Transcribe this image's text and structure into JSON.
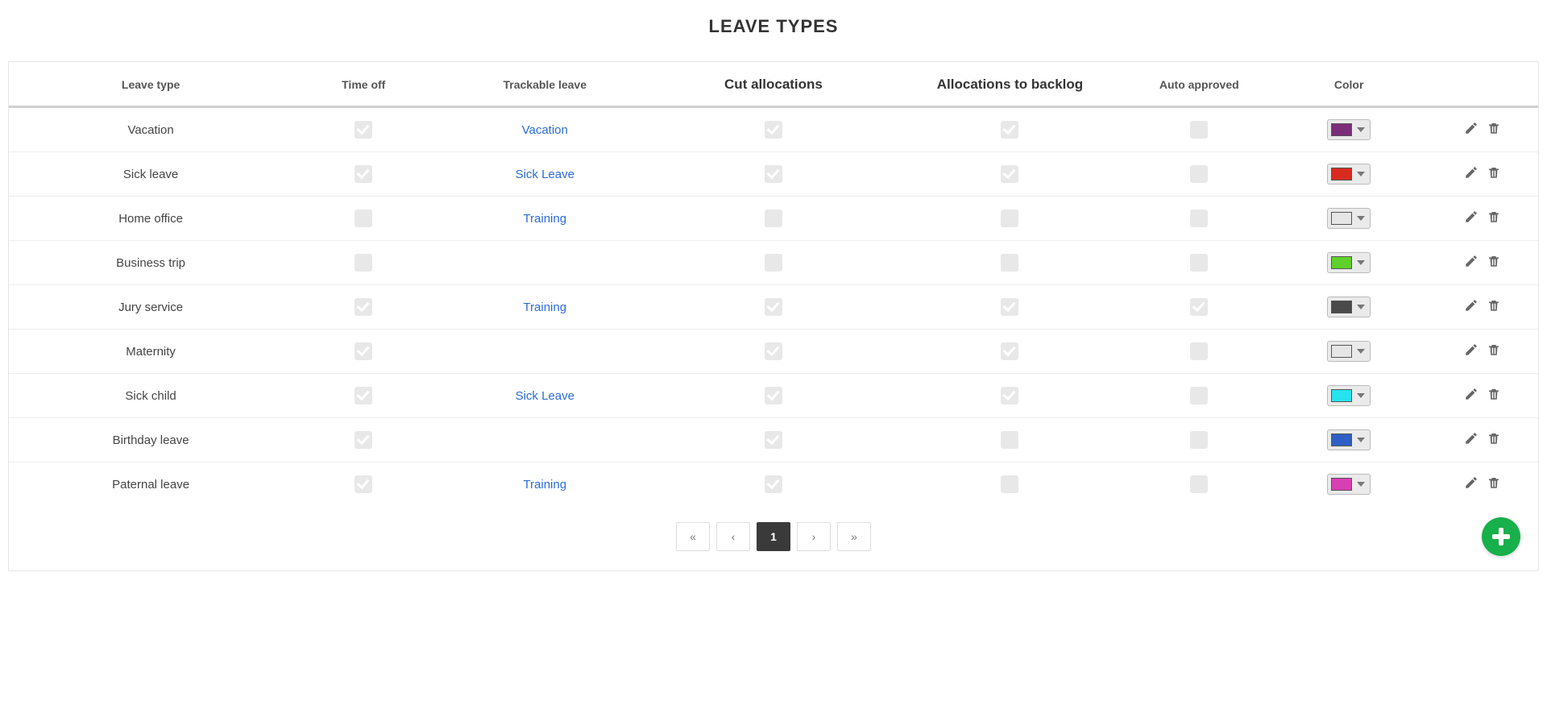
{
  "title": "LEAVE TYPES",
  "columns": {
    "leave_type": "Leave type",
    "time_off": "Time off",
    "trackable": "Trackable leave",
    "cut_alloc": "Cut allocations",
    "alloc_backlog": "Allocations to backlog",
    "auto_approved": "Auto approved",
    "color": "Color"
  },
  "rows": [
    {
      "name": "Vacation",
      "time_off": true,
      "trackable": "Vacation",
      "cut": true,
      "backlog": true,
      "auto": false,
      "color": "#7a2e7a"
    },
    {
      "name": "Sick leave",
      "time_off": true,
      "trackable": "Sick Leave",
      "cut": true,
      "backlog": true,
      "auto": false,
      "color": "#d82b1e"
    },
    {
      "name": "Home office",
      "time_off": false,
      "trackable": "Training",
      "cut": false,
      "backlog": false,
      "auto": false,
      "color": "#e6e6e6"
    },
    {
      "name": "Business trip",
      "time_off": false,
      "trackable": "",
      "cut": false,
      "backlog": false,
      "auto": false,
      "color": "#5fd12a"
    },
    {
      "name": "Jury service",
      "time_off": true,
      "trackable": "Training",
      "cut": true,
      "backlog": true,
      "auto": true,
      "color": "#4a4a4a"
    },
    {
      "name": "Maternity",
      "time_off": true,
      "trackable": "",
      "cut": true,
      "backlog": true,
      "auto": false,
      "color": "#e6e6e6"
    },
    {
      "name": "Sick child",
      "time_off": true,
      "trackable": "Sick Leave",
      "cut": true,
      "backlog": true,
      "auto": false,
      "color": "#26e3ef"
    },
    {
      "name": "Birthday leave",
      "time_off": true,
      "trackable": "",
      "cut": true,
      "backlog": false,
      "auto": false,
      "color": "#2f5fc4"
    },
    {
      "name": "Paternal leave",
      "time_off": true,
      "trackable": "Training",
      "cut": true,
      "backlog": false,
      "auto": false,
      "color": "#d93fb5"
    }
  ],
  "pagination": {
    "first": "«",
    "prev": "‹",
    "current": "1",
    "next": "›",
    "last": "»"
  }
}
